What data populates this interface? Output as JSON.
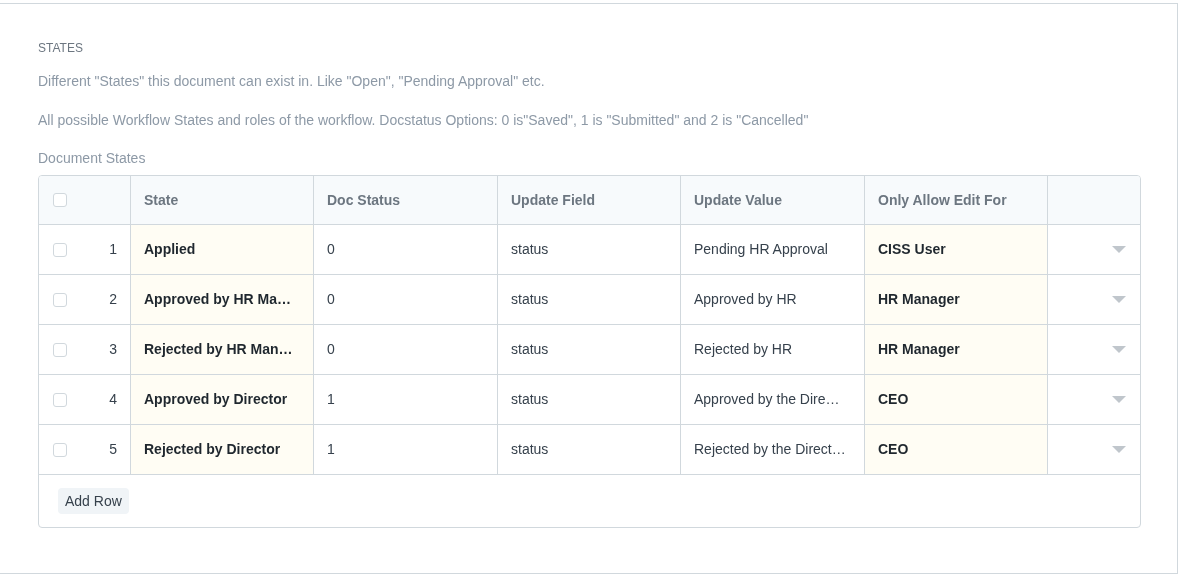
{
  "section": {
    "heading": "STATES",
    "description": "Different \"States\" this document can exist in. Like \"Open\", \"Pending Approval\" etc.",
    "help": "All possible Workflow States and roles of the workflow. Docstatus Options: 0 is\"Saved\", 1 is \"Submitted\" and 2 is \"Cancelled\""
  },
  "table": {
    "label": "Document States",
    "select_all": {
      "checked": false
    },
    "columns": [
      {
        "label": "State",
        "kind": "bold"
      },
      {
        "label": "Doc Status",
        "kind": "plain"
      },
      {
        "label": "Update Field",
        "kind": "plain"
      },
      {
        "label": "Update Value",
        "kind": "plain"
      },
      {
        "label": "Only Allow Edit For",
        "kind": "bold"
      }
    ],
    "rows": [
      {
        "checked": false,
        "index": "1",
        "cells": [
          "Applied",
          "0",
          "status",
          "Pending HR Approval",
          "CISS User"
        ]
      },
      {
        "checked": false,
        "index": "2",
        "cells": [
          "Approved by HR Ma…",
          "0",
          "status",
          "Approved by HR",
          "HR Manager"
        ]
      },
      {
        "checked": false,
        "index": "3",
        "cells": [
          "Rejected by HR Man…",
          "0",
          "status",
          "Rejected by HR",
          "HR Manager"
        ]
      },
      {
        "checked": false,
        "index": "4",
        "cells": [
          "Approved by Director",
          "1",
          "status",
          "Approved by the Dire…",
          "CEO"
        ]
      },
      {
        "checked": false,
        "index": "5",
        "cells": [
          "Rejected by Director",
          "1",
          "status",
          "Rejected by the Direct…",
          "CEO"
        ]
      }
    ],
    "add_button": "Add Row"
  }
}
